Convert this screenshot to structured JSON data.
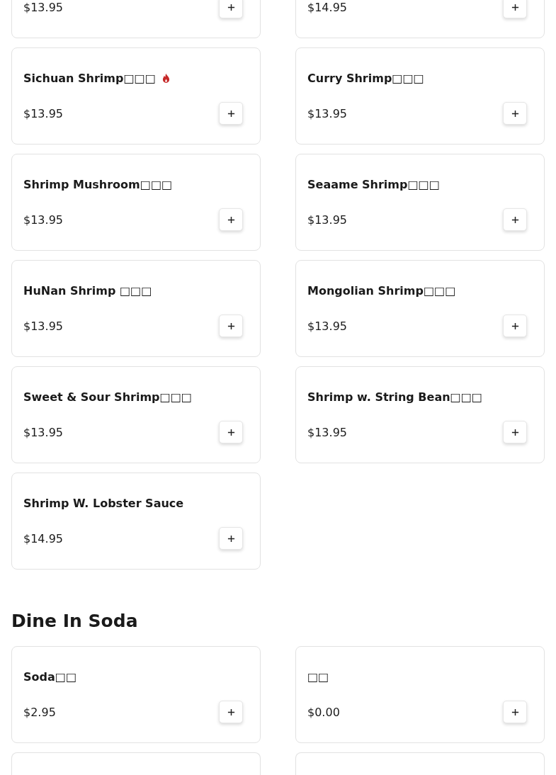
{
  "sections": [
    {
      "items": [
        {
          "kind": "dish",
          "price": "$13.95"
        },
        {
          "kind": "dish",
          "price": "$14.95"
        },
        {
          "kind": "dish",
          "name": "Sichuan Shrimp□□□",
          "price": "$13.95",
          "spicy": true
        },
        {
          "kind": "dish",
          "name": "Curry Shrimp□□□",
          "price": "$13.95",
          "spicy": false
        },
        {
          "kind": "dish",
          "name": "Shrimp Mushroom□□□",
          "price": "$13.95",
          "spicy": false
        },
        {
          "kind": "dish",
          "name": "Seaame Shrimp□□□",
          "price": "$13.95",
          "spicy": false
        },
        {
          "kind": "dish",
          "name": "HuNan Shrimp □□□",
          "price": "$13.95",
          "spicy": false
        },
        {
          "kind": "dish",
          "name": "Mongolian Shrimp□□□",
          "price": "$13.95",
          "spicy": false
        },
        {
          "kind": "dish",
          "name": "Sweet & Sour Shrimp□□□",
          "price": "$13.95",
          "spicy": false
        },
        {
          "kind": "dish",
          "name": "Shrimp w. String Bean□□□",
          "price": "$13.95",
          "spicy": false
        },
        {
          "kind": "dish",
          "name": "Shrimp W. Lobster Sauce",
          "price": "$14.95",
          "spicy": false
        }
      ]
    },
    {
      "title": "Dine In Soda",
      "items": [
        {
          "kind": "dish",
          "name": "Soda□□",
          "price": "$2.95",
          "spicy": false
        },
        {
          "kind": "dish",
          "name": "□□",
          "price": "$0.00",
          "spicy": false
        },
        {
          "kind": "cut-off"
        },
        {
          "kind": "cut-off"
        }
      ]
    }
  ]
}
